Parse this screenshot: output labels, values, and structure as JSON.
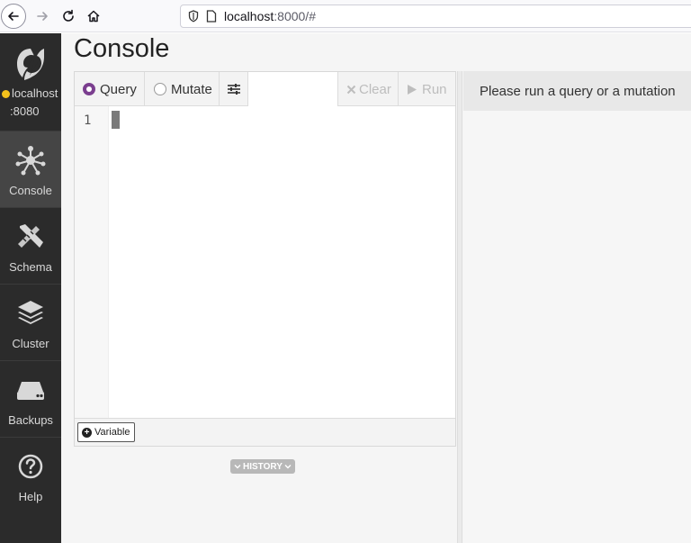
{
  "browser": {
    "url_host": "localhost",
    "url_path": ":8000/#"
  },
  "sidebar": {
    "host_name": "localhost",
    "host_port": ":8080",
    "host_status_color": "#f4c21c",
    "items": [
      {
        "label": "Console",
        "icon": "network-icon",
        "active": true
      },
      {
        "label": "Schema",
        "icon": "pencil-ruler-icon",
        "active": false
      },
      {
        "label": "Cluster",
        "icon": "layers-icon",
        "active": false
      },
      {
        "label": "Backups",
        "icon": "hard-drive-icon",
        "active": false
      },
      {
        "label": "Help",
        "icon": "question-circle-icon",
        "active": false
      }
    ]
  },
  "main": {
    "title": "Console",
    "toolbar": {
      "query_label": "Query",
      "mutate_label": "Mutate",
      "selected_mode": "Query",
      "clear_label": "Clear",
      "run_label": "Run"
    },
    "editor": {
      "line_number": "1"
    },
    "variable_label": "Variable",
    "history_label": "HISTORY",
    "result_message": "Please run a query or a mutation"
  },
  "colors": {
    "sidebar_bg": "#2b2b2b",
    "accent_radio": "#7b3f8f"
  }
}
